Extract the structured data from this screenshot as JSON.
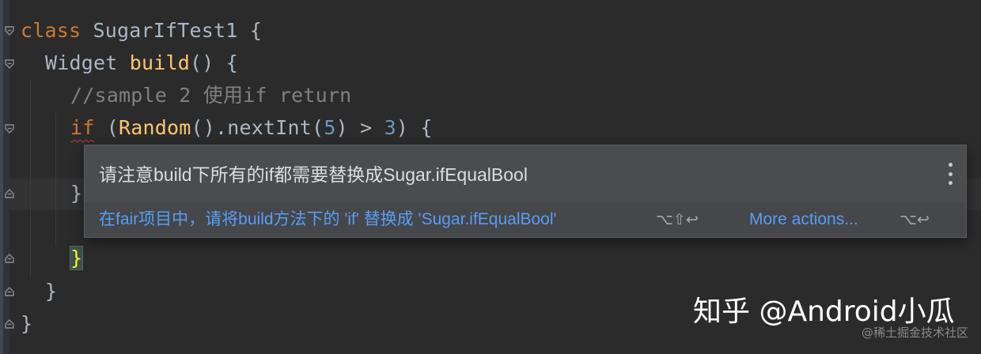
{
  "editor": {
    "lines": {
      "l1": {
        "kw": "class",
        "name": "SugarIfTest1",
        "brace": "{"
      },
      "l2": {
        "type": "Widget",
        "fn": "build",
        "rest": "() {"
      },
      "l3": {
        "comment": "//sample 2 使用if return"
      },
      "l4": {
        "kw": "if",
        "p1": " (",
        "fn": "Random",
        "p2": "().nextInt(",
        "n1": "5",
        "p3": ") > ",
        "n2": "3",
        "p4": ") {"
      },
      "l6": {
        "text": "}"
      },
      "l8": {
        "text": "}"
      },
      "l9": {
        "text": "}"
      },
      "l10": {
        "text": "}"
      }
    }
  },
  "popup": {
    "message": "请注意build下所有的if都需要替换成Sugar.ifEqualBool",
    "action_label": "在fair项目中，请将build方法下的 'if' 替换成 'Sugar.ifEqualBool'",
    "action_shortcut": "⌥⇧↩",
    "more_label": "More actions...",
    "more_shortcut": "⌥↩"
  },
  "watermark": {
    "main": "知乎 @Android小瓜",
    "small": "@稀土掘金技术社区"
  },
  "colors": {
    "background": "#2b2b2b",
    "keyword": "#cc7832",
    "function": "#ffc66d",
    "comment": "#808080",
    "number": "#6897bb",
    "link": "#589df6"
  }
}
